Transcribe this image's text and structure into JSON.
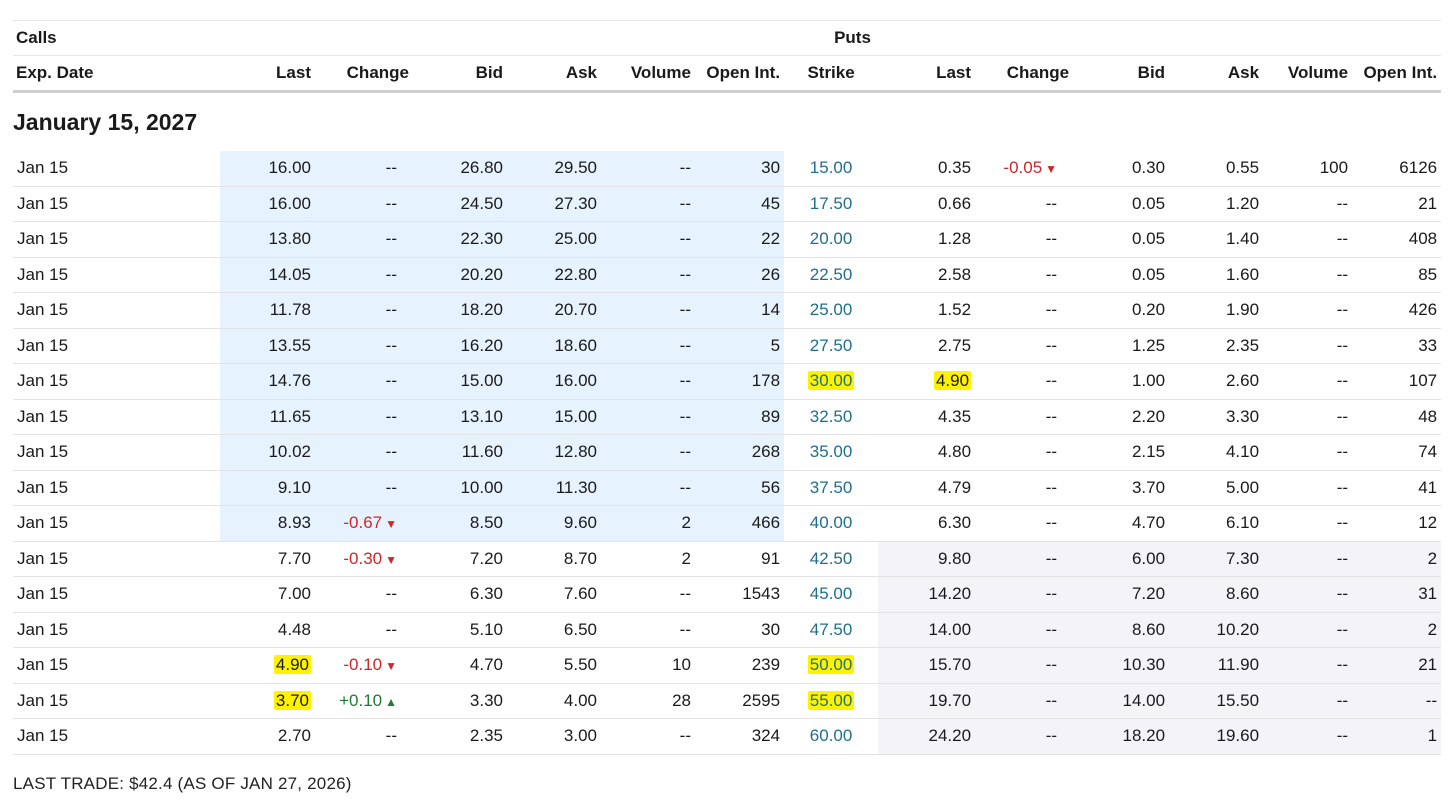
{
  "groups": {
    "calls": "Calls",
    "puts": "Puts"
  },
  "columns": [
    "Exp. Date",
    "Last",
    "Change",
    "Bid",
    "Ask",
    "Volume",
    "Open Int.",
    "Strike",
    "Last",
    "Change",
    "Bid",
    "Ask",
    "Volume",
    "Open Int."
  ],
  "section_title": "January 15, 2027",
  "rows": [
    {
      "date": "Jan 15",
      "c_last": "16.00",
      "c_change": "--",
      "c_dir": "",
      "c_bid": "26.80",
      "c_ask": "29.50",
      "c_vol": "--",
      "c_oi": "30",
      "strike": "15.00",
      "p_last": "0.35",
      "p_change": "-0.05",
      "p_dir": "down",
      "p_bid": "0.30",
      "p_ask": "0.55",
      "p_vol": "100",
      "p_oi": "6126",
      "call_itm": true,
      "put_itm": false,
      "hl": []
    },
    {
      "date": "Jan 15",
      "c_last": "16.00",
      "c_change": "--",
      "c_dir": "",
      "c_bid": "24.50",
      "c_ask": "27.30",
      "c_vol": "--",
      "c_oi": "45",
      "strike": "17.50",
      "p_last": "0.66",
      "p_change": "--",
      "p_dir": "",
      "p_bid": "0.05",
      "p_ask": "1.20",
      "p_vol": "--",
      "p_oi": "21",
      "call_itm": true,
      "put_itm": false,
      "hl": []
    },
    {
      "date": "Jan 15",
      "c_last": "13.80",
      "c_change": "--",
      "c_dir": "",
      "c_bid": "22.30",
      "c_ask": "25.00",
      "c_vol": "--",
      "c_oi": "22",
      "strike": "20.00",
      "p_last": "1.28",
      "p_change": "--",
      "p_dir": "",
      "p_bid": "0.05",
      "p_ask": "1.40",
      "p_vol": "--",
      "p_oi": "408",
      "call_itm": true,
      "put_itm": false,
      "hl": []
    },
    {
      "date": "Jan 15",
      "c_last": "14.05",
      "c_change": "--",
      "c_dir": "",
      "c_bid": "20.20",
      "c_ask": "22.80",
      "c_vol": "--",
      "c_oi": "26",
      "strike": "22.50",
      "p_last": "2.58",
      "p_change": "--",
      "p_dir": "",
      "p_bid": "0.05",
      "p_ask": "1.60",
      "p_vol": "--",
      "p_oi": "85",
      "call_itm": true,
      "put_itm": false,
      "hl": []
    },
    {
      "date": "Jan 15",
      "c_last": "11.78",
      "c_change": "--",
      "c_dir": "",
      "c_bid": "18.20",
      "c_ask": "20.70",
      "c_vol": "--",
      "c_oi": "14",
      "strike": "25.00",
      "p_last": "1.52",
      "p_change": "--",
      "p_dir": "",
      "p_bid": "0.20",
      "p_ask": "1.90",
      "p_vol": "--",
      "p_oi": "426",
      "call_itm": true,
      "put_itm": false,
      "hl": []
    },
    {
      "date": "Jan 15",
      "c_last": "13.55",
      "c_change": "--",
      "c_dir": "",
      "c_bid": "16.20",
      "c_ask": "18.60",
      "c_vol": "--",
      "c_oi": "5",
      "strike": "27.50",
      "p_last": "2.75",
      "p_change": "--",
      "p_dir": "",
      "p_bid": "1.25",
      "p_ask": "2.35",
      "p_vol": "--",
      "p_oi": "33",
      "call_itm": true,
      "put_itm": false,
      "hl": []
    },
    {
      "date": "Jan 15",
      "c_last": "14.76",
      "c_change": "--",
      "c_dir": "",
      "c_bid": "15.00",
      "c_ask": "16.00",
      "c_vol": "--",
      "c_oi": "178",
      "strike": "30.00",
      "p_last": "4.90",
      "p_change": "--",
      "p_dir": "",
      "p_bid": "1.00",
      "p_ask": "2.60",
      "p_vol": "--",
      "p_oi": "107",
      "call_itm": true,
      "put_itm": false,
      "hl": [
        "strike",
        "p_last"
      ]
    },
    {
      "date": "Jan 15",
      "c_last": "11.65",
      "c_change": "--",
      "c_dir": "",
      "c_bid": "13.10",
      "c_ask": "15.00",
      "c_vol": "--",
      "c_oi": "89",
      "strike": "32.50",
      "p_last": "4.35",
      "p_change": "--",
      "p_dir": "",
      "p_bid": "2.20",
      "p_ask": "3.30",
      "p_vol": "--",
      "p_oi": "48",
      "call_itm": true,
      "put_itm": false,
      "hl": []
    },
    {
      "date": "Jan 15",
      "c_last": "10.02",
      "c_change": "--",
      "c_dir": "",
      "c_bid": "11.60",
      "c_ask": "12.80",
      "c_vol": "--",
      "c_oi": "268",
      "strike": "35.00",
      "p_last": "4.80",
      "p_change": "--",
      "p_dir": "",
      "p_bid": "2.15",
      "p_ask": "4.10",
      "p_vol": "--",
      "p_oi": "74",
      "call_itm": true,
      "put_itm": false,
      "hl": []
    },
    {
      "date": "Jan 15",
      "c_last": "9.10",
      "c_change": "--",
      "c_dir": "",
      "c_bid": "10.00",
      "c_ask": "11.30",
      "c_vol": "--",
      "c_oi": "56",
      "strike": "37.50",
      "p_last": "4.79",
      "p_change": "--",
      "p_dir": "",
      "p_bid": "3.70",
      "p_ask": "5.00",
      "p_vol": "--",
      "p_oi": "41",
      "call_itm": true,
      "put_itm": false,
      "hl": []
    },
    {
      "date": "Jan 15",
      "c_last": "8.93",
      "c_change": "-0.67",
      "c_dir": "down",
      "c_bid": "8.50",
      "c_ask": "9.60",
      "c_vol": "2",
      "c_oi": "466",
      "strike": "40.00",
      "p_last": "6.30",
      "p_change": "--",
      "p_dir": "",
      "p_bid": "4.70",
      "p_ask": "6.10",
      "p_vol": "--",
      "p_oi": "12",
      "call_itm": true,
      "put_itm": false,
      "hl": []
    },
    {
      "date": "Jan 15",
      "c_last": "7.70",
      "c_change": "-0.30",
      "c_dir": "down",
      "c_bid": "7.20",
      "c_ask": "8.70",
      "c_vol": "2",
      "c_oi": "91",
      "strike": "42.50",
      "p_last": "9.80",
      "p_change": "--",
      "p_dir": "",
      "p_bid": "6.00",
      "p_ask": "7.30",
      "p_vol": "--",
      "p_oi": "2",
      "call_itm": false,
      "put_itm": true,
      "hl": []
    },
    {
      "date": "Jan 15",
      "c_last": "7.00",
      "c_change": "--",
      "c_dir": "",
      "c_bid": "6.30",
      "c_ask": "7.60",
      "c_vol": "--",
      "c_oi": "1543",
      "strike": "45.00",
      "p_last": "14.20",
      "p_change": "--",
      "p_dir": "",
      "p_bid": "7.20",
      "p_ask": "8.60",
      "p_vol": "--",
      "p_oi": "31",
      "call_itm": false,
      "put_itm": true,
      "hl": []
    },
    {
      "date": "Jan 15",
      "c_last": "4.48",
      "c_change": "--",
      "c_dir": "",
      "c_bid": "5.10",
      "c_ask": "6.50",
      "c_vol": "--",
      "c_oi": "30",
      "strike": "47.50",
      "p_last": "14.00",
      "p_change": "--",
      "p_dir": "",
      "p_bid": "8.60",
      "p_ask": "10.20",
      "p_vol": "--",
      "p_oi": "2",
      "call_itm": false,
      "put_itm": true,
      "hl": []
    },
    {
      "date": "Jan 15",
      "c_last": "4.90",
      "c_change": "-0.10",
      "c_dir": "down",
      "c_bid": "4.70",
      "c_ask": "5.50",
      "c_vol": "10",
      "c_oi": "239",
      "strike": "50.00",
      "p_last": "15.70",
      "p_change": "--",
      "p_dir": "",
      "p_bid": "10.30",
      "p_ask": "11.90",
      "p_vol": "--",
      "p_oi": "21",
      "call_itm": false,
      "put_itm": true,
      "hl": [
        "c_last",
        "strike"
      ]
    },
    {
      "date": "Jan 15",
      "c_last": "3.70",
      "c_change": "+0.10",
      "c_dir": "up",
      "c_bid": "3.30",
      "c_ask": "4.00",
      "c_vol": "28",
      "c_oi": "2595",
      "strike": "55.00",
      "p_last": "19.70",
      "p_change": "--",
      "p_dir": "",
      "p_bid": "14.00",
      "p_ask": "15.50",
      "p_vol": "--",
      "p_oi": "--",
      "call_itm": false,
      "put_itm": true,
      "hl": [
        "c_last",
        "strike"
      ]
    },
    {
      "date": "Jan 15",
      "c_last": "2.70",
      "c_change": "--",
      "c_dir": "",
      "c_bid": "2.35",
      "c_ask": "3.00",
      "c_vol": "--",
      "c_oi": "324",
      "strike": "60.00",
      "p_last": "24.20",
      "p_change": "--",
      "p_dir": "",
      "p_bid": "18.20",
      "p_ask": "19.60",
      "p_vol": "--",
      "p_oi": "1",
      "call_itm": false,
      "put_itm": true,
      "hl": []
    }
  ],
  "footer": "LAST TRADE: $42.4 (AS OF JAN 27, 2026)",
  "colors": {
    "call_itm_bg": "#e6f2fd",
    "put_itm_bg": "#f4f4f8",
    "highlight": "#fff200",
    "negative": "#d0262b",
    "positive": "#1f7a32",
    "strike": "#1f6f8b"
  },
  "icons": {
    "down": "triangle-down-icon",
    "up": "triangle-up-icon"
  }
}
